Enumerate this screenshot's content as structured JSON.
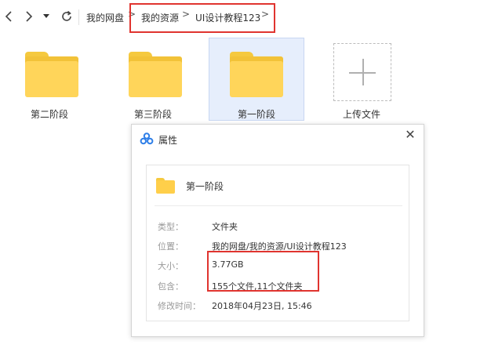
{
  "navbar": {
    "breadcrumbs": [
      "我的网盘",
      "我的资源",
      "UI设计教程123"
    ],
    "separator": ">"
  },
  "items": [
    {
      "type": "folder",
      "label": "第二阶段",
      "selected": false
    },
    {
      "type": "folder",
      "label": "第三阶段",
      "selected": false
    },
    {
      "type": "folder",
      "label": "第一阶段",
      "selected": true
    },
    {
      "type": "upload",
      "label": "上传文件"
    }
  ],
  "dialog": {
    "title": "属性",
    "close_glyph": "✕",
    "name": "第一阶段",
    "properties": [
      {
        "label": "类型：",
        "value": "文件夹"
      },
      {
        "label": "位置：",
        "value": "我的网盘/我的资源/UI设计教程123"
      },
      {
        "label": "大小：",
        "value": "3.77GB"
      },
      {
        "label": "包含：",
        "value": "155个文件,11个文件夹"
      },
      {
        "label": "修改时间：",
        "value": "2018年04月23日, 15:46"
      }
    ]
  },
  "colors": {
    "highlight_border": "#e0342f",
    "folder_yellow": "#ffd55a",
    "selected_bg": "#e6eefc",
    "logo_blue": "#2f7fe8"
  },
  "icons": [
    "back-arrow-icon",
    "forward-arrow-icon",
    "dropdown-caret-icon",
    "refresh-icon",
    "folder-icon",
    "plus-icon",
    "baidu-cloud-logo-icon",
    "close-icon"
  ]
}
